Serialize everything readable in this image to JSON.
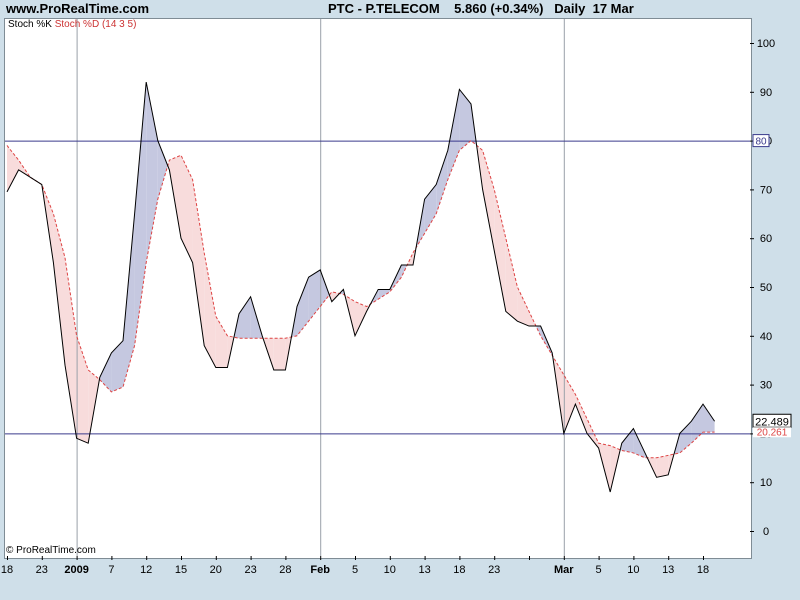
{
  "header": {
    "site": "www.ProRealTime.com",
    "ticker": "PTC - P.TELECOM",
    "price": "5.860 (+0.34%)",
    "period": "Daily",
    "date": "17 Mar"
  },
  "legend": {
    "k_label": "Stoch %K",
    "d_label": "Stoch %D",
    "params": "(14 3 5)"
  },
  "footer": "© ProRealTime.com",
  "colors": {
    "k_line": "#000000",
    "d_line": "#dd4444",
    "k_above_fill": "#c5c8e0",
    "d_above_fill": "#f8dcdc",
    "level_line": "#3a3a8c",
    "grid": "#9aa0a8",
    "background": "#cfdfe9"
  },
  "chart_data": {
    "type": "line",
    "title": "PTC - P.TELECOM",
    "ylim": [
      -5,
      105
    ],
    "grid": true,
    "y_ticks": [
      "0",
      "10",
      "20",
      "30",
      "40",
      "50",
      "60",
      "70",
      "80",
      "90",
      "100"
    ],
    "x_ticks": [
      {
        "i": 0,
        "label": "18"
      },
      {
        "i": 3,
        "label": "23"
      },
      {
        "i": 6,
        "label": "2009",
        "bold": true
      },
      {
        "i": 9,
        "label": "7"
      },
      {
        "i": 12,
        "label": "12"
      },
      {
        "i": 15,
        "label": "15"
      },
      {
        "i": 18,
        "label": "20"
      },
      {
        "i": 21,
        "label": "23"
      },
      {
        "i": 24,
        "label": "28"
      },
      {
        "i": 27,
        "label": "Feb",
        "bold": true
      },
      {
        "i": 30,
        "label": "5"
      },
      {
        "i": 33,
        "label": "10"
      },
      {
        "i": 36,
        "label": "13"
      },
      {
        "i": 39,
        "label": "18"
      },
      {
        "i": 42,
        "label": "23"
      },
      {
        "i": 45,
        "label": ""
      },
      {
        "i": 48,
        "label": "Mar",
        "bold": true
      },
      {
        "i": 51,
        "label": "5"
      },
      {
        "i": 54,
        "label": "10"
      },
      {
        "i": 57,
        "label": "13"
      },
      {
        "i": 60,
        "label": "18"
      }
    ],
    "vertical_grid_at": [
      6,
      27,
      48
    ],
    "levels": [
      {
        "value": 80,
        "label": "80"
      },
      {
        "value": 20,
        "label": ""
      }
    ],
    "last_values": {
      "k": "22.489",
      "d": "20.261"
    },
    "series": [
      {
        "name": "Stoch %K",
        "values": [
          69.5,
          74,
          72.5,
          71,
          55,
          34,
          19,
          18,
          31.5,
          36.5,
          39,
          65,
          92,
          80,
          74,
          60,
          55,
          38,
          33.5,
          33.5,
          44.5,
          48,
          40,
          33,
          33,
          46,
          52,
          53.5,
          47,
          49.5,
          40,
          45,
          49.5,
          49.5,
          54.5,
          54.5,
          68,
          71,
          78,
          90.5,
          87.5,
          70,
          57.5,
          45,
          43,
          42,
          42,
          36.5,
          20,
          26,
          20,
          17,
          8,
          18,
          21,
          16,
          11,
          11.5,
          20,
          22.5,
          26,
          22.489
        ]
      },
      {
        "name": "Stoch %D",
        "values": [
          79,
          76,
          72.5,
          71,
          65,
          56,
          40,
          33,
          31,
          28.5,
          29.5,
          38,
          55,
          68,
          76,
          77,
          72,
          57,
          44,
          40,
          39.5,
          39.5,
          39.5,
          39.5,
          39.5,
          40,
          43,
          46,
          49,
          48.5,
          47,
          46,
          47.5,
          49,
          52,
          57,
          61,
          65,
          72,
          78,
          80,
          78,
          70,
          60,
          50,
          45,
          40,
          36,
          32,
          28,
          23,
          18,
          17.5,
          16.5,
          16,
          15,
          15,
          15.5,
          16,
          18,
          20.261,
          20.261
        ]
      }
    ]
  }
}
